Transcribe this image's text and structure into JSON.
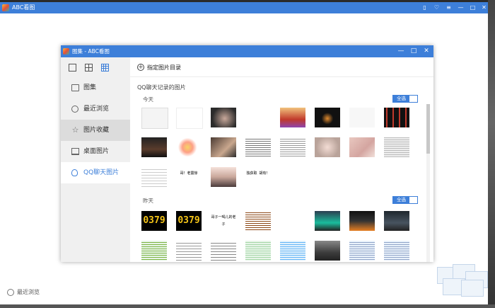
{
  "app": {
    "title": "ABC看图",
    "bottom_label": "最近浏览"
  },
  "dialog": {
    "title": "图集 - ABC看图",
    "toolbar": {
      "add_folder_label": "指定图片目录"
    },
    "sidebar": {
      "items": [
        {
          "label": "图集",
          "icon": "album-icon"
        },
        {
          "label": "最近浏览",
          "icon": "recent-icon"
        },
        {
          "label": "图片收藏",
          "icon": "favorites-icon"
        },
        {
          "label": "桌面图片",
          "icon": "desktop-icon"
        },
        {
          "label": "QQ聊天图片",
          "icon": "qq-icon"
        }
      ]
    },
    "section_title": "QQ聊天记录的图片",
    "select_all_label": "全选",
    "groups": [
      {
        "label": "今天",
        "caption_1": "哥！老震惊",
        "caption_2": "独获取 胡有！"
      },
      {
        "label": "昨天",
        "number_1": "0379",
        "number_2": "0379",
        "caption_3": "哥子一喝儿的老子"
      }
    ]
  },
  "colors": {
    "accent": "#3d7fd9",
    "sidebar_bg": "#f0f0f0"
  }
}
